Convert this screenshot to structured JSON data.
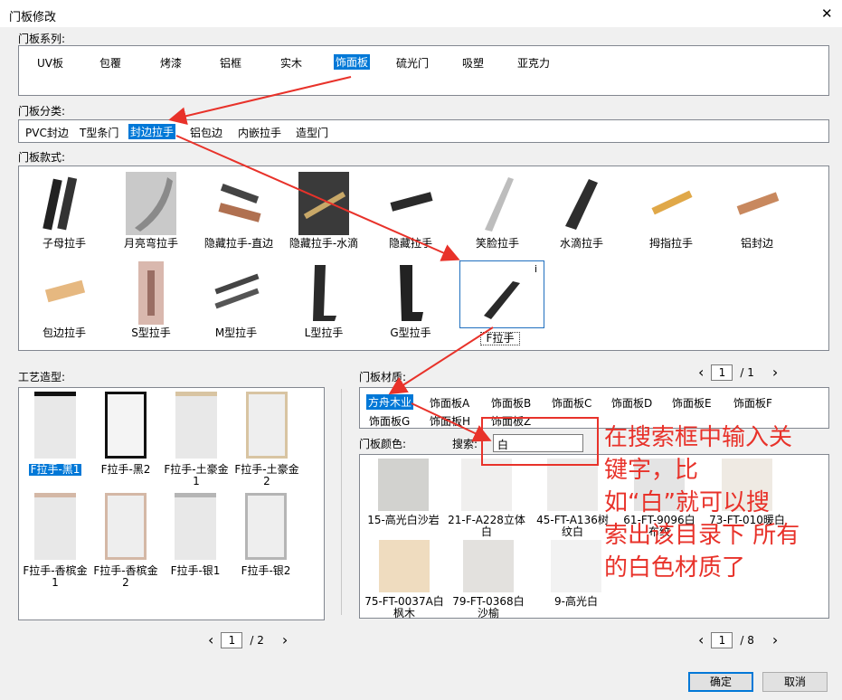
{
  "window": {
    "title": "门板修改",
    "close": "✕"
  },
  "series": {
    "label": "门板系列:",
    "items": [
      "UV板",
      "包覆",
      "烤漆",
      "铝框",
      "实木",
      "饰面板",
      "硫光门",
      "吸塑",
      "亚克力"
    ]
  },
  "category": {
    "label": "门板分类:",
    "items": [
      "PVC封边",
      "T型条门",
      "封边拉手",
      "铝包边",
      "内嵌拉手",
      "造型门"
    ]
  },
  "styles": {
    "label": "门板款式:",
    "items": [
      "子母拉手",
      "月亮弯拉手",
      "隐藏拉手-直边",
      "隐藏拉手-水滴",
      "隐藏拉手",
      "笑脸拉手",
      "水滴拉手",
      "拇指拉手",
      "铝封边",
      "包边拉手",
      "S型拉手",
      "M型拉手",
      "L型拉手",
      "G型拉手",
      "F拉手"
    ],
    "info": "i"
  },
  "craft": {
    "label": "工艺造型:",
    "items": [
      "F拉手-黑1",
      "F拉手-黑2",
      "F拉手-土豪金1",
      "F拉手-土豪金2",
      "F拉手-香槟金1",
      "F拉手-香槟金2",
      "F拉手-银1",
      "F拉手-银2"
    ],
    "page": "1",
    "total": "/ 2",
    "prev": "‹",
    "next": "›"
  },
  "material": {
    "label": "门板材质:",
    "items": [
      "方舟木业",
      "饰面板A",
      "饰面板B",
      "饰面板C",
      "饰面板D",
      "饰面板E",
      "饰面板F",
      "饰面板G",
      "饰面板H",
      "饰面板Z"
    ],
    "page": "1",
    "total": "/ 1",
    "prev": "‹",
    "next": "›"
  },
  "color": {
    "label": "门板颜色:",
    "search_label": "搜索:",
    "search_value": "白",
    "items": [
      "15-高光白沙岩",
      "21-F-A228立体白",
      "45-FT-A136树纹白",
      "61-FT-9096白布纹",
      "73-FT-010暖白",
      "75-FT-0037A白枫木",
      "79-FT-0368白沙榆",
      "9-高光白"
    ],
    "page": "1",
    "total": "/ 8",
    "prev": "‹",
    "next": "›"
  },
  "annotation": {
    "line1": "在搜索框中输入关",
    "line2": "键字，比",
    "line3": "如“白”就可以搜",
    "line4": "索出该目录下 所有",
    "line5": "的白色材质了"
  },
  "buttons": {
    "ok": "确定",
    "cancel": "取消"
  },
  "colors": {
    "selection": "#0078d7",
    "annotation": "#e8322a"
  }
}
